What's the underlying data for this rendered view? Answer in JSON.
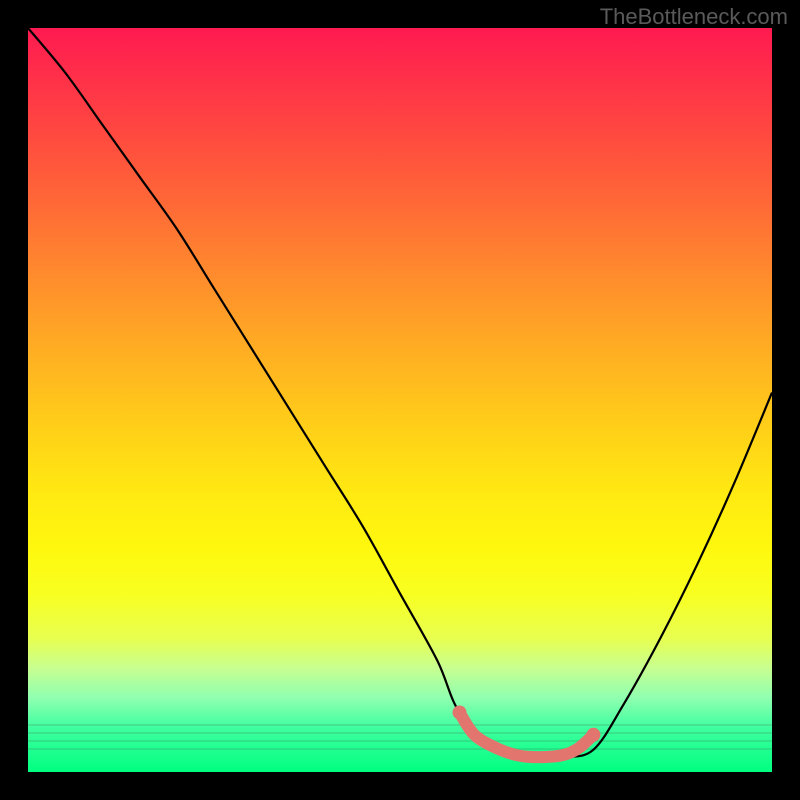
{
  "watermark": "TheBottleneck.com",
  "chart_data": {
    "type": "line",
    "title": "",
    "xlabel": "",
    "ylabel": "",
    "xlim": [
      0,
      100
    ],
    "ylim": [
      0,
      100
    ],
    "series": [
      {
        "name": "bottleneck-curve",
        "x": [
          0,
          5,
          10,
          15,
          20,
          25,
          30,
          35,
          40,
          45,
          50,
          55,
          58,
          63,
          68,
          72,
          76,
          80,
          85,
          90,
          95,
          100
        ],
        "values": [
          100,
          94,
          87,
          80,
          73,
          65,
          57,
          49,
          41,
          33,
          24,
          15,
          8,
          3,
          2,
          2,
          3,
          9,
          18,
          28,
          39,
          51
        ]
      }
    ],
    "highlight_segment": {
      "name": "optimal-range",
      "x": [
        58,
        60,
        63,
        66,
        69,
        72,
        74,
        76
      ],
      "values": [
        8,
        5,
        3.2,
        2.2,
        2.0,
        2.3,
        3.2,
        5
      ],
      "color": "#e2766e"
    },
    "background_gradient": {
      "top_color": "#ff1a50",
      "mid_color": "#ffe812",
      "bottom_color": "#00ff80"
    }
  }
}
